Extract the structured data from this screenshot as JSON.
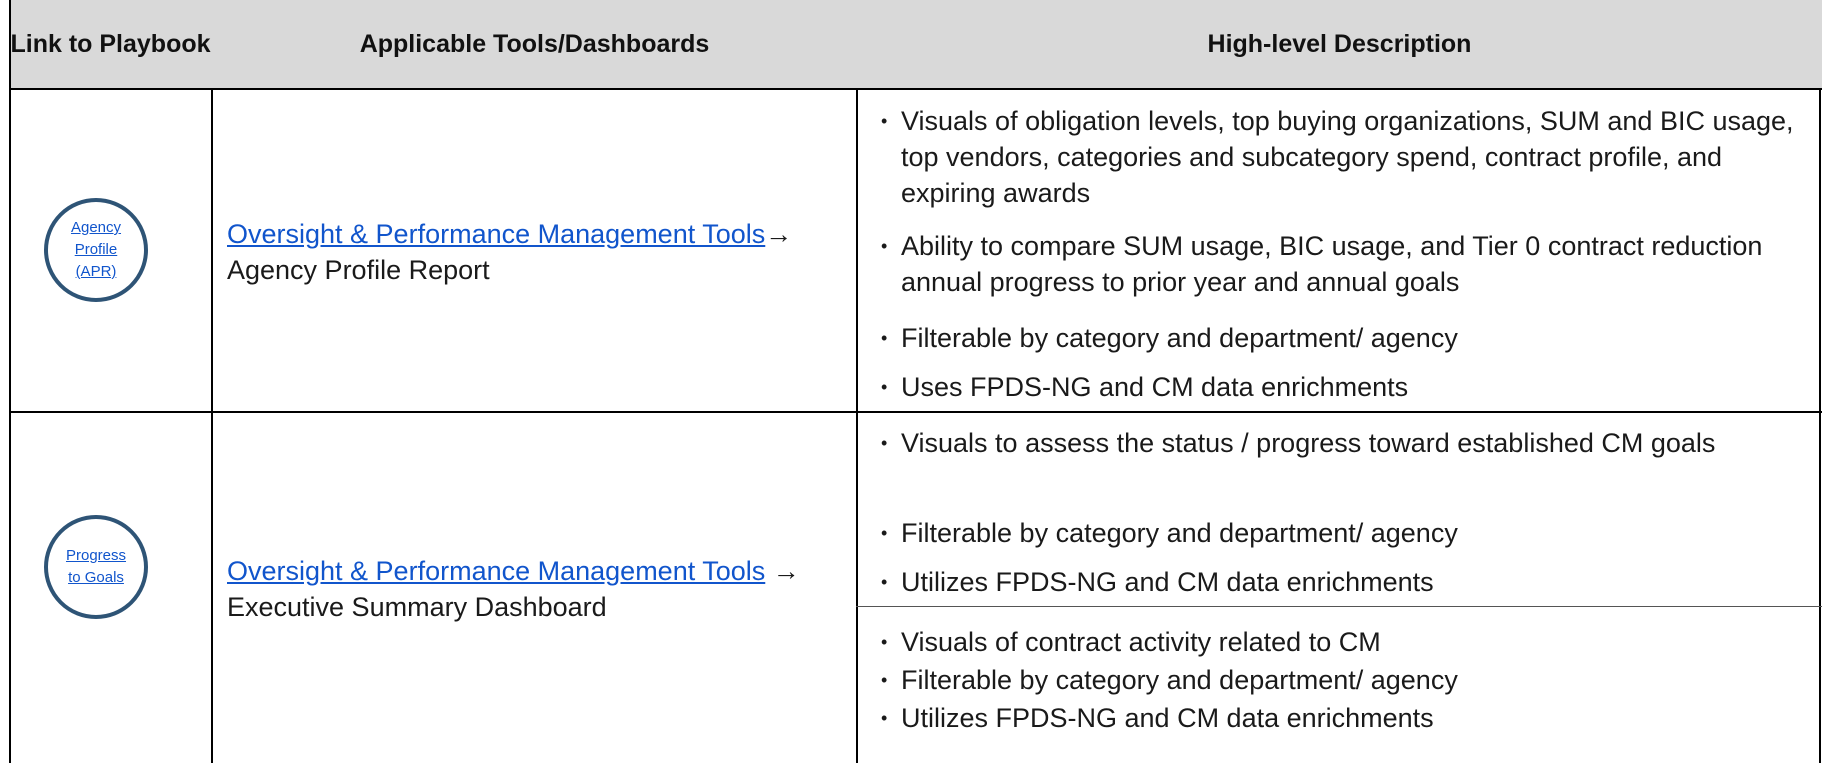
{
  "header": {
    "col1": "Link to Playbook",
    "col2": "Applicable Tools/Dashboards",
    "col3": "High-level Description"
  },
  "rows": [
    {
      "playbook_link": [
        "Agency",
        "Profile",
        "(APR)"
      ],
      "tool_link": "Oversight & Performance Management Tools",
      "tool_suffix": "→ Agency Profile Report",
      "bullets": [
        "Visuals of obligation levels, top buying organizations, SUM and BIC usage, top vendors, categories and subcategory spend, contract profile, and expiring awards",
        "Ability to compare SUM usage, BIC usage, and Tier 0 contract reduction annual progress to prior year and annual goals",
        "Filterable by category and department/ agency",
        "Uses FPDS-NG and CM data enrichments"
      ]
    },
    {
      "playbook_link": [
        "Progress",
        "to Goals"
      ],
      "tool_link": "Oversight & Performance Management Tools",
      "tool_suffix": " → Executive Summary Dashboard",
      "bullets": [
        "Visuals to assess the status / progress toward established CM goals",
        "Filterable by category and department/ agency",
        "Utilizes FPDS-NG and CM data enrichments"
      ],
      "bullets_b": [
        "Visuals of contract activity related to CM",
        "Filterable by category and department/ agency",
        "Utilizes FPDS-NG and CM data enrichments"
      ]
    }
  ],
  "colors": {
    "header_bg": "#d9d9d9",
    "circle_border": "#2e5476",
    "link": "#1155cc"
  }
}
